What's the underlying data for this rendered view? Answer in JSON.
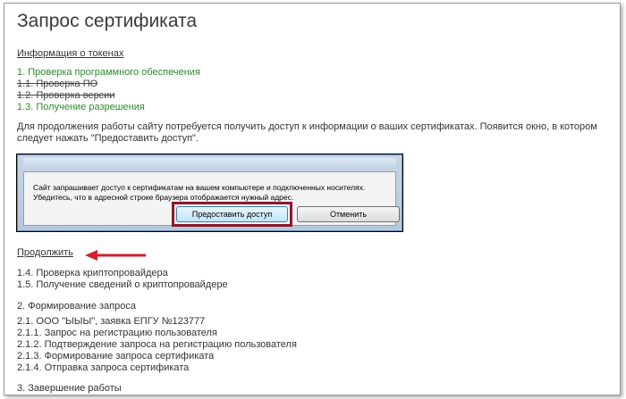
{
  "page": {
    "title": "Запрос сертификата",
    "tokens_link": "Информация о токенах",
    "continue_link": "Продолжить",
    "steps_top": [
      {
        "text": "1. Проверка программного обеспечения",
        "style": "green"
      },
      {
        "text": "1.1. Проверка ПО",
        "style": "strike"
      },
      {
        "text": "1.2. Проверка версии",
        "style": "strike"
      },
      {
        "text": "1.3. Получение разрешения",
        "style": "green"
      }
    ],
    "instruction": "Для продолжения работы сайту потребуется получить доступ к информации о ваших сертификатах. Появится окно, в котором следует нажать \"Предоставить доступ\".",
    "steps_bottom": [
      "1.4. Проверка криптопровайдера",
      "1.5. Получение сведений о криптопровайдере",
      "2. Формирование запроса",
      "2.1. ООО \"ЫЫЫ\", заявка ЕПГУ №123777",
      "2.1.1. Запрос на регистрацию пользователя",
      "2.1.2. Подтверждение запроса на регистрацию пользователя",
      "2.1.3. Формирование запроса сертификата",
      "2.1.4. Отправка запроса сертификата",
      "3. Завершение работы"
    ]
  },
  "dialog": {
    "message_line1": "Сайт запрашивает доступ к сертификатам на вашем компьютере и подключенных носителях.",
    "message_line2": "Убедитесь, что в адресной строке браузера отображается нужный адрес.",
    "grant_label": "Предоставить доступ",
    "cancel_label": "Отменить"
  },
  "colors": {
    "green": "#2e8b2e",
    "highlight": "#8b1a2b",
    "arrow": "#d0202a"
  }
}
